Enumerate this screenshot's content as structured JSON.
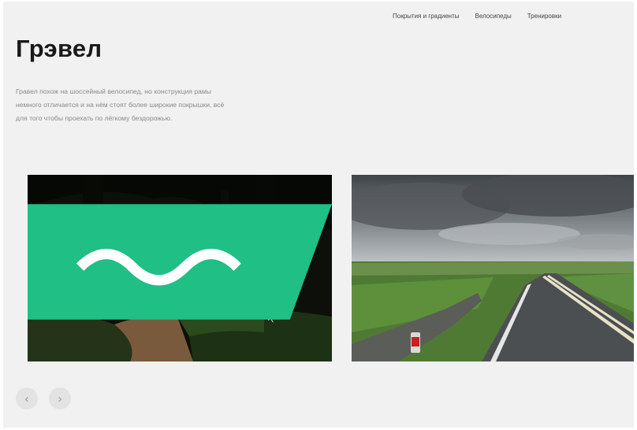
{
  "nav": {
    "items": [
      "Покрытия и градиенты",
      "Велосипеды",
      "Тренировки"
    ]
  },
  "hero": {
    "title": "Грэвел",
    "description": "Гравел похож на шоссейный велосипед, но конструкция рамы немного отличается и на нём стоят более широкие покрышки, всё для того чтобы проехать по лёгкому бездорожью."
  },
  "slider": {
    "prev_icon": "chevron-left-icon",
    "next_icon": "chevron-right-icon",
    "prev_glyph": "‹",
    "next_glyph": "›"
  },
  "colors": {
    "badge": "#1fbf86",
    "background": "#f1f1f1"
  }
}
